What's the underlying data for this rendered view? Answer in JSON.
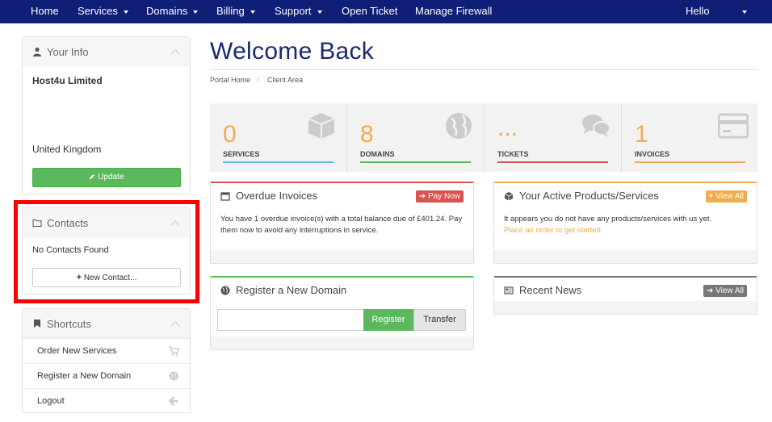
{
  "nav": {
    "home": "Home",
    "services": "Services",
    "domains": "Domains",
    "billing": "Billing",
    "support": "Support",
    "open_ticket": "Open Ticket",
    "manage_firewall": "Manage Firewall",
    "hello": "Hello"
  },
  "sidebar": {
    "your_info": {
      "title": "Your Info",
      "company": "Host4u Limited",
      "country": "United Kingdom",
      "update_label": "Update"
    },
    "contacts": {
      "title": "Contacts",
      "empty_text": "No Contacts Found",
      "new_contact_label": "New Contact..."
    },
    "shortcuts": {
      "title": "Shortcuts",
      "items": [
        {
          "label": "Order New Services",
          "icon": "cart-icon"
        },
        {
          "label": "Register a New Domain",
          "icon": "globe-icon"
        },
        {
          "label": "Logout",
          "icon": "arrow-left-icon"
        }
      ]
    }
  },
  "main": {
    "title": "Welcome Back",
    "breadcrumb": [
      "Portal Home",
      "/",
      "Client Area"
    ],
    "stats": [
      {
        "value": "0",
        "label": "SERVICES",
        "color": "#5bc0de",
        "icon": "cube-icon"
      },
      {
        "value": "8",
        "label": "DOMAINS",
        "color": "#5cb85c",
        "icon": "globe-icon"
      },
      {
        "value": "...",
        "label": "TICKETS",
        "color": "#d9534f",
        "icon": "comments-icon"
      },
      {
        "value": "1",
        "label": "INVOICES",
        "color": "#f0ad4e",
        "icon": "credit-card-icon"
      }
    ],
    "overdue": {
      "title": "Overdue Invoices",
      "button": "Pay Now",
      "text": "You have 1 overdue invoice(s) with a total balance due of £401.24. Pay them now to avoid any interruptions in service."
    },
    "products": {
      "title": "Your Active Products/Services",
      "button": "View All",
      "text": "It appears you do not have any products/services with us yet.",
      "link": "Place an order to get started"
    },
    "register_domain": {
      "title": "Register a New Domain",
      "register_label": "Register",
      "transfer_label": "Transfer",
      "placeholder": ""
    },
    "news": {
      "title": "Recent News",
      "button": "View All"
    }
  },
  "colors": {
    "nav_bg": "#0f1f78",
    "accent_orange": "#f0ad4e",
    "success": "#5cb85c",
    "danger": "#d9534f",
    "info": "#5bc0de",
    "highlight": "#ff0000"
  }
}
